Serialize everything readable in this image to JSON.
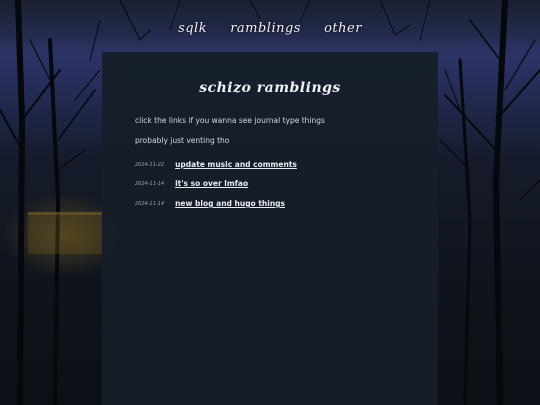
{
  "nav": {
    "items": [
      {
        "label": "sqlk"
      },
      {
        "label": "ramblings"
      },
      {
        "label": "other"
      }
    ]
  },
  "page": {
    "title": "schizo ramblings",
    "intro_lines": [
      "click the links if you wanna see journal type things",
      "probably just venting tho"
    ]
  },
  "posts": [
    {
      "date": "2024-11-22",
      "title": "update music and comments"
    },
    {
      "date": "2024-11-14",
      "title": "it's so over lmfao"
    },
    {
      "date": "2024-11-14",
      "title": "new blog and hugo things"
    }
  ],
  "colors": {
    "panel": "#161e28",
    "text": "#d4d9e1",
    "link": "#e8ecf2",
    "sky": "#2c3466"
  }
}
